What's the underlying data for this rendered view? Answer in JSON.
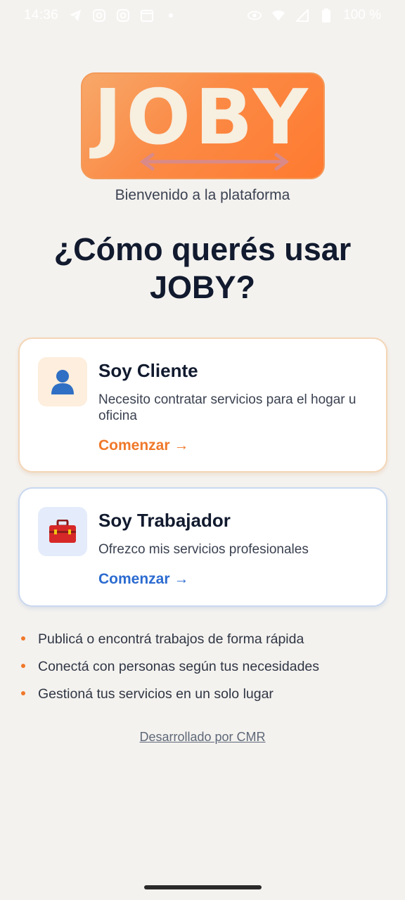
{
  "status_bar": {
    "time": "14:36",
    "battery": "100 %",
    "left_icons": [
      "telegram-icon",
      "instagram-icon",
      "instagram-icon",
      "calendar-icon",
      "dot-icon"
    ],
    "right_icons": [
      "eye-icon",
      "wifi-icon",
      "signal-icon",
      "battery-icon"
    ]
  },
  "logo": {
    "text": "JOBY"
  },
  "subtitle": "Bienvenido a la plataforma",
  "headline": "¿Cómo querés usar JOBY?",
  "cards": {
    "client": {
      "icon": "person-icon",
      "title": "Soy Cliente",
      "description": "Necesito contratar servicios para el hogar u oficina",
      "cta": "Comenzar →"
    },
    "worker": {
      "icon": "toolbox-icon",
      "title": "Soy Trabajador",
      "description": "Ofrezco mis servicios profesionales",
      "cta": "Comenzar →"
    }
  },
  "bullets": [
    "Publicá o encontrá trabajos de forma rápida",
    "Conectá con personas según tus necesidades",
    "Gestioná tus servicios en un solo lugar"
  ],
  "footer": {
    "link": "Desarrollado por CMR"
  },
  "colors": {
    "accent_orange": "#f0782a",
    "accent_blue": "#2c6bd0",
    "background": "#f4f2ef"
  }
}
